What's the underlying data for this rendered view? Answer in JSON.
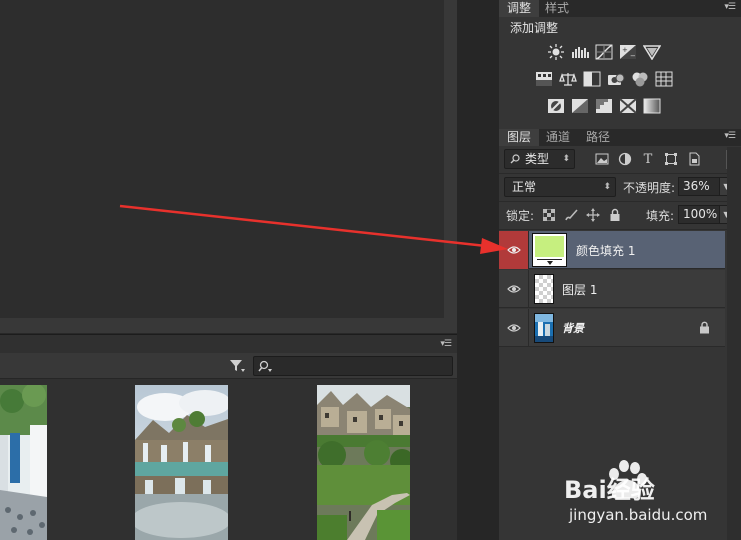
{
  "adjustments_panel": {
    "tabs": [
      "调整",
      "样式"
    ],
    "title": "添加调整",
    "icons_row1": [
      "brightness-contrast-icon",
      "levels-icon",
      "curves-icon",
      "exposure-icon",
      "vibrance-icon"
    ],
    "icons_row2": [
      "hue-saturation-icon",
      "color-balance-icon",
      "black-white-icon",
      "photo-filter-icon",
      "channel-mixer-icon",
      "color-lookup-icon"
    ],
    "icons_row3": [
      "invert-icon",
      "posterize-icon",
      "threshold-icon",
      "selective-color-icon",
      "gradient-map-icon"
    ]
  },
  "layers_panel": {
    "tabs": [
      "图层",
      "通道",
      "路径"
    ],
    "filter_kind": "类型",
    "blend_mode": "正常",
    "opacity_label": "不透明度:",
    "opacity_value": "36%",
    "lock_label": "锁定:",
    "fill_label": "填充:",
    "fill_value": "100%",
    "layers": [
      {
        "name": "颜色填充 1",
        "selected": true,
        "thumb_color": "#c6ef7f"
      },
      {
        "name": "图层 1",
        "selected": false
      },
      {
        "name": "背景",
        "selected": false,
        "locked": true
      }
    ]
  },
  "annotation": {
    "arrow_color": "#e8312c"
  },
  "watermark": {
    "brand": "Bai经验",
    "url": "jingyan.baidu.com"
  }
}
